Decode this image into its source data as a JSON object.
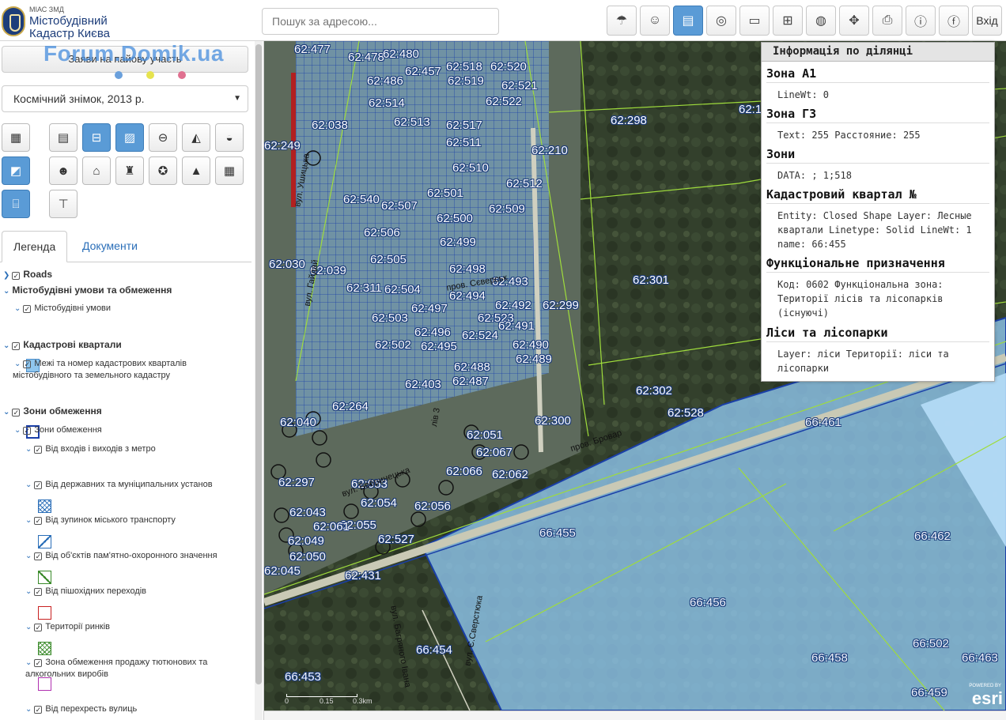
{
  "header": {
    "logo_small": "МІАС ЗМД",
    "logo_title_1": "Містобудівний",
    "logo_title_2": "Кадастр Києва",
    "search_placeholder": "Пошук за адресою...",
    "tools": [
      {
        "name": "weather-icon",
        "glyph": "☂",
        "active": false
      },
      {
        "name": "person-icon",
        "glyph": "☺",
        "active": false
      },
      {
        "name": "clipboard-icon",
        "glyph": "▤",
        "active": true
      },
      {
        "name": "compass-icon",
        "glyph": "◎",
        "active": false
      },
      {
        "name": "ruler-icon",
        "glyph": "▭",
        "active": false
      },
      {
        "name": "measure-area-icon",
        "glyph": "⊞",
        "active": false
      },
      {
        "name": "globe-pin-icon",
        "glyph": "◍",
        "active": false
      },
      {
        "name": "move-icon",
        "glyph": "✥",
        "active": false
      },
      {
        "name": "print-icon",
        "glyph": "⎙",
        "active": false
      },
      {
        "name": "info-icon",
        "glyph": "ⓘ",
        "active": false
      },
      {
        "name": "facebook-icon",
        "glyph": "ⓕ",
        "active": false
      }
    ],
    "login_label": "Вхід"
  },
  "sidebar": {
    "apply_button": "Заяви на пайову участь",
    "watermark": "Forum.Domik.ua",
    "dot_colors": [
      "#6aa0dc",
      "#e6e34e",
      "#e07090"
    ],
    "basemap_value": "Космічний знімок, 2013 р.",
    "tabs": [
      "Легенда",
      "Документи"
    ]
  },
  "legend": {
    "roads": "Roads",
    "urban_conditions": "Містобудівні умови та обмеження",
    "urban_conditions_sub": "Містобудівні умови",
    "cadastral": "Кадастрові квартали",
    "cadastral_sub_1": "Межі та номер кадастрових кварталів",
    "cadastral_sub_2": "містобудівного та земельного кадастру",
    "restrictions": "Зони обмеження",
    "restrictions_sub": "Зони обмеження",
    "items": [
      "Від входів і виходів з метро",
      "Від державних та муніципальних установ",
      "Від зупинок міського транспорту",
      "Від об'єктів пам'ятно-охоронного значення",
      "Від пішохідних переходів",
      "Території ринків",
      "Зона обмеження продажу тютюнових та",
      "алкогольних виробів",
      "Від перехресть вулиць"
    ]
  },
  "map": {
    "labels": [
      "62:477",
      "62:478",
      "62:480",
      "62:518",
      "62:520",
      "62:457",
      "62:486",
      "62:519",
      "62:521",
      "62:522",
      "62:514",
      "62:513",
      "62:517",
      "62:298",
      "62:038",
      "62:511",
      "62:249",
      "62:210",
      "62:510",
      "62:512",
      "62:540",
      "62:501",
      "62:507",
      "62:509",
      "62:500",
      "62:506",
      "62:499",
      "62:505",
      "62:498",
      "62:030",
      "62:039",
      "62:493",
      "62:301",
      "62:311",
      "62:504",
      "62:494",
      "62:497",
      "62:492",
      "62:299",
      "62:503",
      "62:523",
      "62:496",
      "62:491",
      "62:502",
      "62:495",
      "62:524",
      "62:490",
      "62:489",
      "62:488",
      "62:403",
      "62:487",
      "62:302",
      "62:528",
      "62:264",
      "62:300",
      "62:040",
      "62:051",
      "62:067",
      "62:062",
      "62:297",
      "62:055",
      "62:061",
      "62:066",
      "62:054",
      "62:056",
      "62:043",
      "62:053",
      "62:527",
      "62:049",
      "62:050",
      "62:045",
      "62:431",
      "66:461",
      "66:455",
      "66:462",
      "66:456",
      "66:454",
      "66:458",
      "66:502",
      "66:463",
      "66:453",
      "66:459",
      "62:1"
    ],
    "streets": [
      "вул. Ушицька",
      "вул. Гайдай",
      "вул. Бобринецька",
      "пров. Бровар",
      "вул. Багряного Івана",
      "вул. Є.Сверстюка",
      "лів 3",
      "пров. Сєверськ"
    ],
    "scale_labels": [
      "0",
      "0.15",
      "0.3km"
    ],
    "esri_powered": "POWERED BY",
    "esri_brand": "esri"
  },
  "info_panel": {
    "title": "Інформація по ділянці",
    "sections": [
      {
        "heading": "Зона А1",
        "body": "LineWt: 0"
      },
      {
        "heading": "Зона ГЗ",
        "body": "Text: 255 Расстояние: 255"
      },
      {
        "heading": "Зони",
        "body": "DATA: ; 1;518"
      },
      {
        "heading": "Кадастровий квартал №",
        "body": "Entity: Closed Shape Layer: Лесные квартали Linetype: Solid LineWt: 1 name: 66:455"
      },
      {
        "heading": "Функціональне призначення",
        "body": "Код: 0602 Функціональна зона: Території лісів та лісопарків (існуючі)"
      },
      {
        "heading": "Ліси та лісопарки",
        "body": "Layer: ліси Території: ліси та лісопарки"
      }
    ]
  },
  "colors": {
    "accent": "#5a9bd6",
    "parcel_fill": "#8fc6ee",
    "parcel_border": "#1a3fa8",
    "boundary_green": "#9fdc3c",
    "forest": "#2f3e2a"
  }
}
